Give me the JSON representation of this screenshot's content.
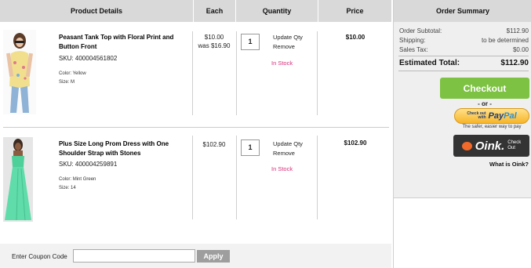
{
  "table": {
    "headers": {
      "product": "Product Details",
      "each": "Each",
      "quantity": "Quantity",
      "price": "Price"
    }
  },
  "items": [
    {
      "name": "Peasant Tank Top with Floral Print and Button Front",
      "sku": "SKU: 400004561802",
      "color_label": "Color:",
      "color": "Yellow",
      "size_label": "Size:",
      "size": "M",
      "each": "$10.00",
      "was": "was $16.90",
      "qty": "1",
      "update": "Update Qty",
      "remove": "Remove",
      "stock": "In Stock",
      "price": "$10.00"
    },
    {
      "name": "Plus Size Long Prom Dress with One Shoulder Strap with Stones",
      "sku": "SKU: 400004259891",
      "color_label": "Color:",
      "color": "Mint Green",
      "size_label": "Size:",
      "size": "14",
      "each": "$102.90",
      "qty": "1",
      "update": "Update Qty",
      "remove": "Remove",
      "stock": "In Stock",
      "price": "$102.90"
    }
  ],
  "coupon": {
    "label": "Enter Coupon Code",
    "value": "",
    "apply": "Apply"
  },
  "summary": {
    "title": "Order Summary",
    "subtotal_label": "Order Subtotal:",
    "subtotal": "$112.90",
    "shipping_label": "Shipping:",
    "shipping": "to be determined",
    "tax_label": "Sales Tax:",
    "tax": "$0.00",
    "total_label": "Estimated Total:",
    "total": "$112.90",
    "checkout": "Checkout",
    "or": "- or -",
    "paypal_small_1": "Check out",
    "paypal_small_2": "with",
    "paypal_pay": "Pay",
    "paypal_pal": "Pal",
    "paypal_tagline": "The safer, easier way to pay",
    "oink_brand": "Oink.",
    "oink_check": "Check",
    "oink_out": "Out",
    "what_is_oink": "What is Oink?"
  },
  "colors": {
    "checkout": "#7dc242",
    "in_stock": "#d6307a",
    "header_bg": "#d9d9d9"
  }
}
